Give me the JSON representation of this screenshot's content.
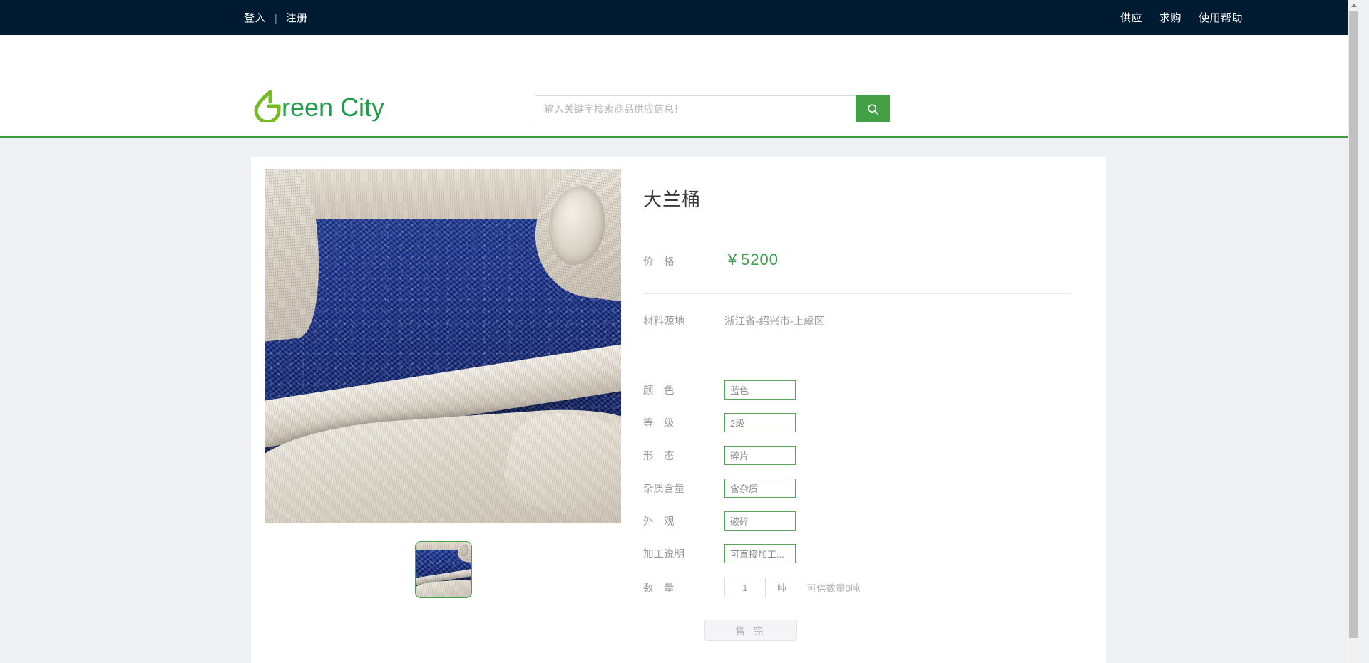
{
  "topbar": {
    "login": "登入",
    "separator": "|",
    "register": "注册",
    "supply": "供应",
    "demand": "求购",
    "help": "使用帮助"
  },
  "header": {
    "logo_text": "Green City",
    "search": {
      "placeholder": "输入关键字搜索商品供应信息！",
      "value": "",
      "button_icon": "search-icon"
    }
  },
  "product": {
    "title": "大兰桶",
    "price_label": "价　格",
    "price_value": "￥5200",
    "origin_label": "材料源地",
    "origin_value": "浙江省-绍兴市-上虞区",
    "attributes": [
      {
        "label": "颜　色",
        "value": "蓝色"
      },
      {
        "label": "等　级",
        "value": "2级"
      },
      {
        "label": "形　态",
        "value": "碎片"
      },
      {
        "label": "杂质含量",
        "value": "含杂质"
      },
      {
        "label": "外　观",
        "value": "破碎"
      },
      {
        "label": "加工说明",
        "value": "可直接加工..."
      }
    ],
    "quantity": {
      "label": "数　量",
      "value": "1",
      "unit": "吨",
      "stock_text": "可供数量0吨"
    },
    "buy_button": "售 完",
    "gallery": {
      "main_alt": "blue-plastic-flakes-in-white-woven-bag",
      "thumb_alt": "blue-plastic-flakes-thumbnail"
    }
  },
  "colors": {
    "topbar_bg": "#011b33",
    "brand_green": "#3d9b3d",
    "price_green": "#3d9b4a",
    "page_bg": "#eff0f4",
    "card_bg": "#ffffff"
  }
}
